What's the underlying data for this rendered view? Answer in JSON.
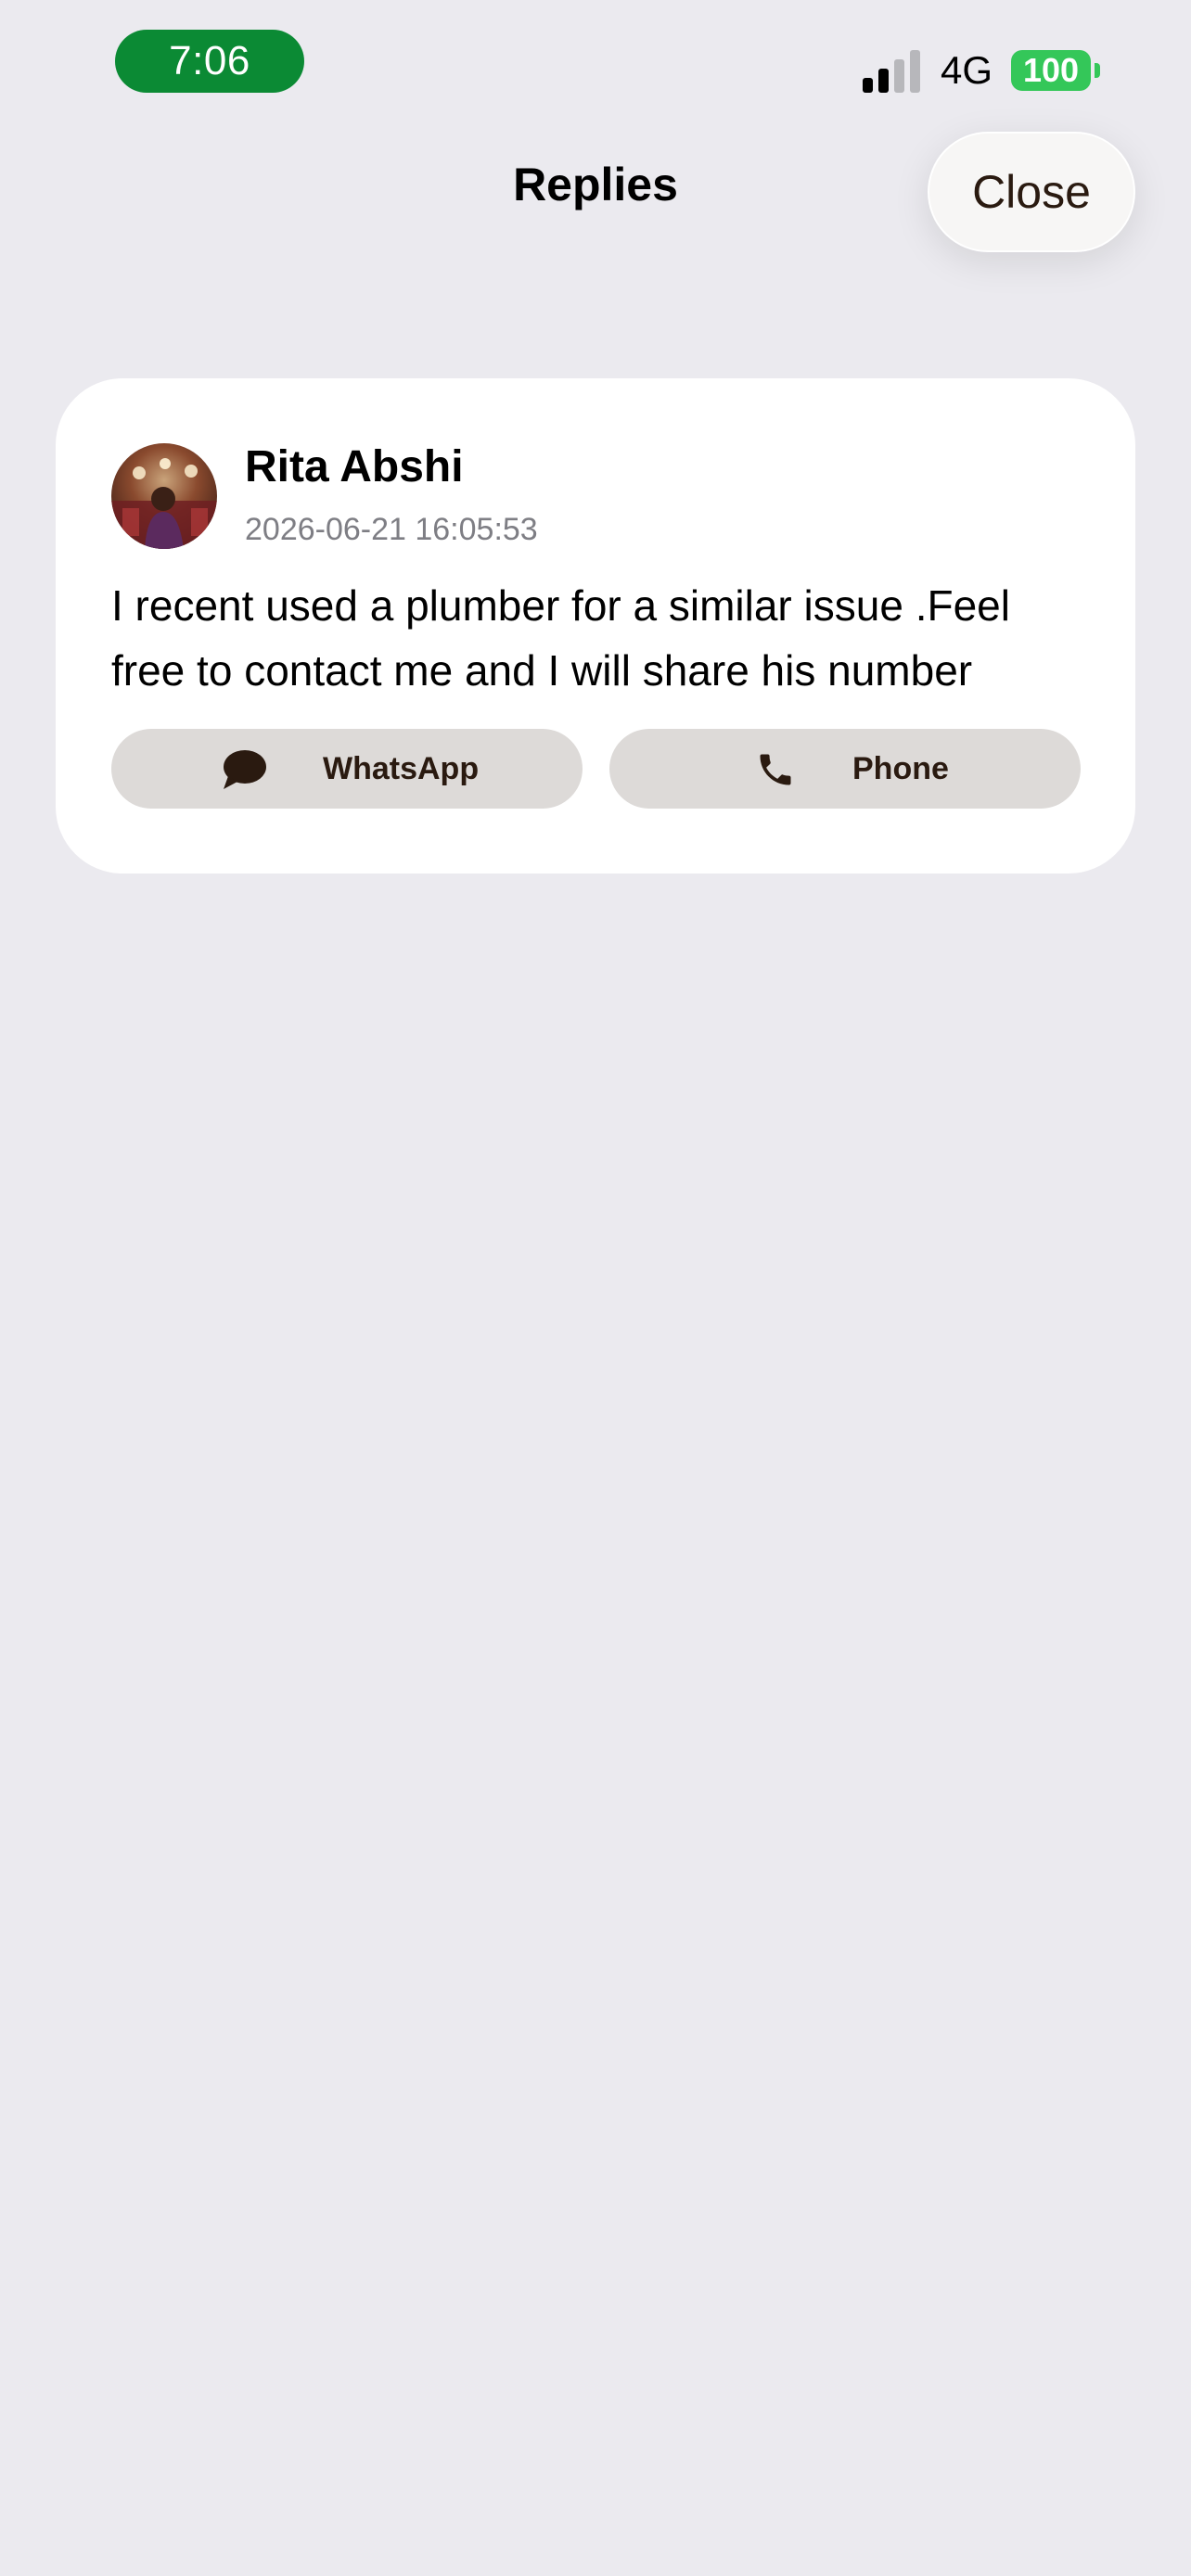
{
  "status_bar": {
    "time": "7:06",
    "network": "4G",
    "battery": "100",
    "time_pill_color": "#0B8A34",
    "battery_color": "#34C759",
    "signal_bars_active": 2,
    "signal_bars_total": 4
  },
  "header": {
    "title": "Replies",
    "close_label": "Close"
  },
  "replies": [
    {
      "author": "Rita Abshi",
      "timestamp": "2026-06-21 16:05:53",
      "message": "I recent used a plumber for a similar issue .Feel free to contact me and I will share his number",
      "avatar_icon": "user-avatar-photo",
      "actions": [
        {
          "label": "WhatsApp",
          "icon": "chat-bubble-icon"
        },
        {
          "label": "Phone",
          "icon": "phone-icon"
        }
      ]
    }
  ],
  "colors": {
    "background": "#EBEAEF",
    "card": "#FFFFFF",
    "action_button": "#DDDAD8",
    "action_text": "#2A1A10"
  }
}
